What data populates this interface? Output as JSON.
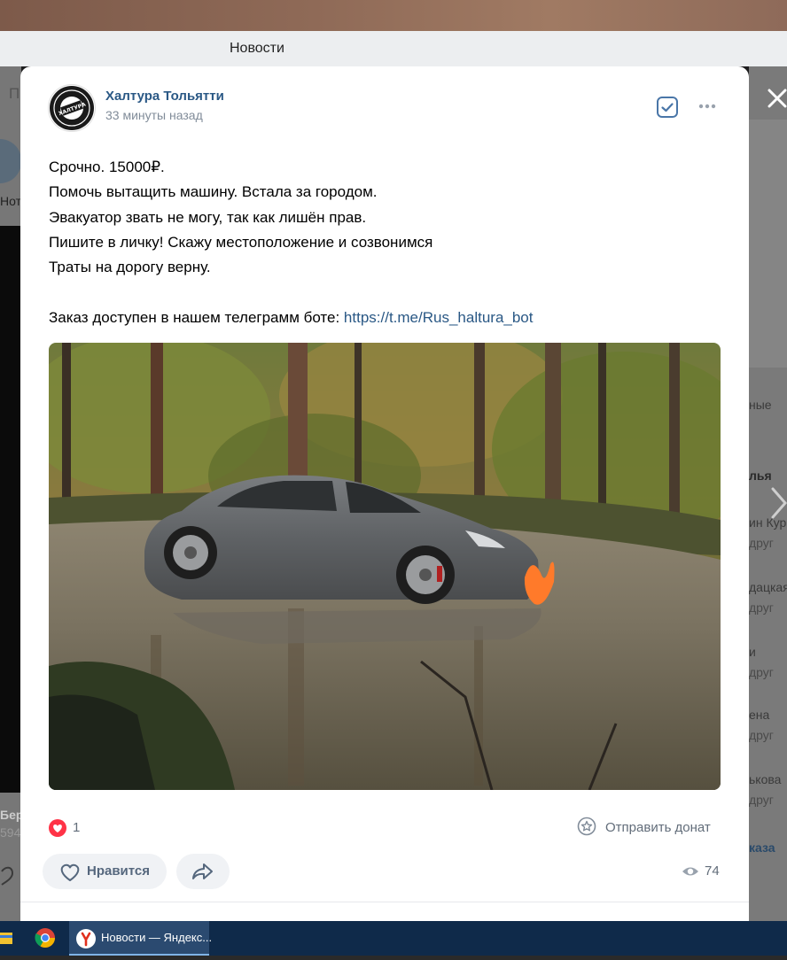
{
  "browser": {
    "tab_title": "Новости",
    "taskbar_window_label": "Новости — Яндекс..."
  },
  "background_page": {
    "left_fragments": [
      "П",
      "Нот",
      "Бер",
      "594"
    ],
    "right_fragments": [
      "ные",
      "лья",
      "ин Кур",
      "друг",
      "дацкая",
      "друг",
      "и",
      "друг",
      "ена",
      "друг",
      "ькова",
      "друг",
      "каза"
    ]
  },
  "post": {
    "author": "Халтура Тольятти",
    "time": "33 минуты назад",
    "avatar_text": "ХАЛТУРА",
    "text_lines": [
      "Срочно. 15000₽.",
      "Помочь вытащить машину. Встала за городом.",
      "Эвакуатор звать не могу, так как лишён прав.",
      "Пишите в личку! Скажу местоположение и созвонимся",
      "Траты на дорогу верну.",
      ""
    ],
    "telegram_prefix": "Заказ доступен в нашем телеграмм боте: ",
    "telegram_link": "https://t.me/Rus_haltura_bot",
    "photo_alt": "grey car stuck in a forest puddle",
    "likes_count": "1",
    "donate_label": "Отправить донат",
    "like_button_label": "Нравится",
    "views_count": "74"
  },
  "colors": {
    "link": "#2a5885",
    "accent": "#4a76a8",
    "heart": "#ff3347",
    "muted": "#818c99"
  },
  "icons": {
    "close": "close-icon",
    "check": "checkbox-checked-icon",
    "more": "more-horizontal-icon",
    "heart": "heart-filled-icon",
    "donate": "star-circle-icon",
    "like": "heart-outline-icon",
    "share": "share-arrow-icon",
    "views": "eye-icon"
  }
}
